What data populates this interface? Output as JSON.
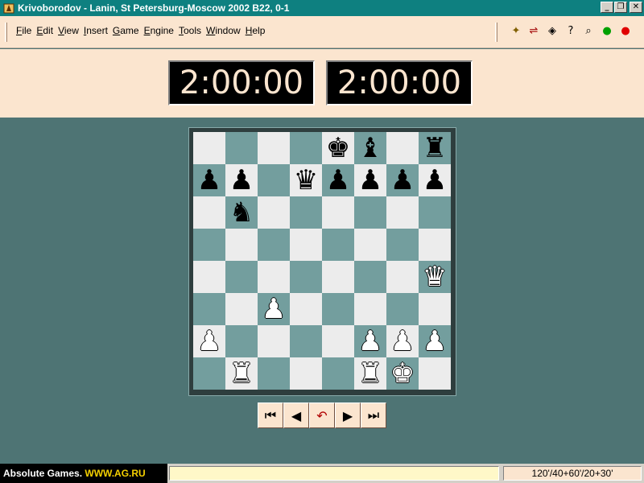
{
  "window": {
    "title": "Krivoborodov - Lanin, St Petersburg-Moscow 2002  B22, 0-1",
    "minimize": "_",
    "restore": "❐",
    "close": "✕"
  },
  "menu": {
    "items": [
      "File",
      "Edit",
      "View",
      "Insert",
      "Game",
      "Engine",
      "Tools",
      "Window",
      "Help"
    ]
  },
  "toolbar": {
    "icons": [
      "new-game-icon",
      "flip-icon",
      "analyze-icon",
      "hint-icon",
      "search-icon",
      "accept-icon",
      "stop-icon"
    ]
  },
  "clocks": {
    "white": "2:00:00",
    "black": "2:00:00"
  },
  "board": {
    "squares": [
      [
        "",
        "",
        "",
        "",
        "bK",
        "bB",
        "",
        "bR"
      ],
      [
        "bP",
        "bP",
        "",
        "bQ",
        "bP",
        "bP",
        "bP",
        "bP"
      ],
      [
        "",
        "bN",
        "",
        "",
        "",
        "",
        "",
        ""
      ],
      [
        "",
        "",
        "",
        "",
        "",
        "",
        "",
        ""
      ],
      [
        "",
        "",
        "",
        "",
        "",
        "",
        "",
        "wQ"
      ],
      [
        "",
        "",
        "wP",
        "",
        "",
        "",
        "",
        ""
      ],
      [
        "wP",
        "",
        "",
        "",
        "",
        "wP",
        "wP",
        "wP"
      ],
      [
        "",
        "wR",
        "",
        "",
        "",
        "wR",
        "wK",
        ""
      ]
    ]
  },
  "navigation": {
    "first": "⏮",
    "prev": "◀",
    "undo": "↶",
    "next": "▶",
    "last": "⏭"
  },
  "status": {
    "brand_prefix": "Absolute Games.",
    "brand_url": "WWW.AG.RU",
    "time_control": "120'/40+60'/20+30'"
  }
}
